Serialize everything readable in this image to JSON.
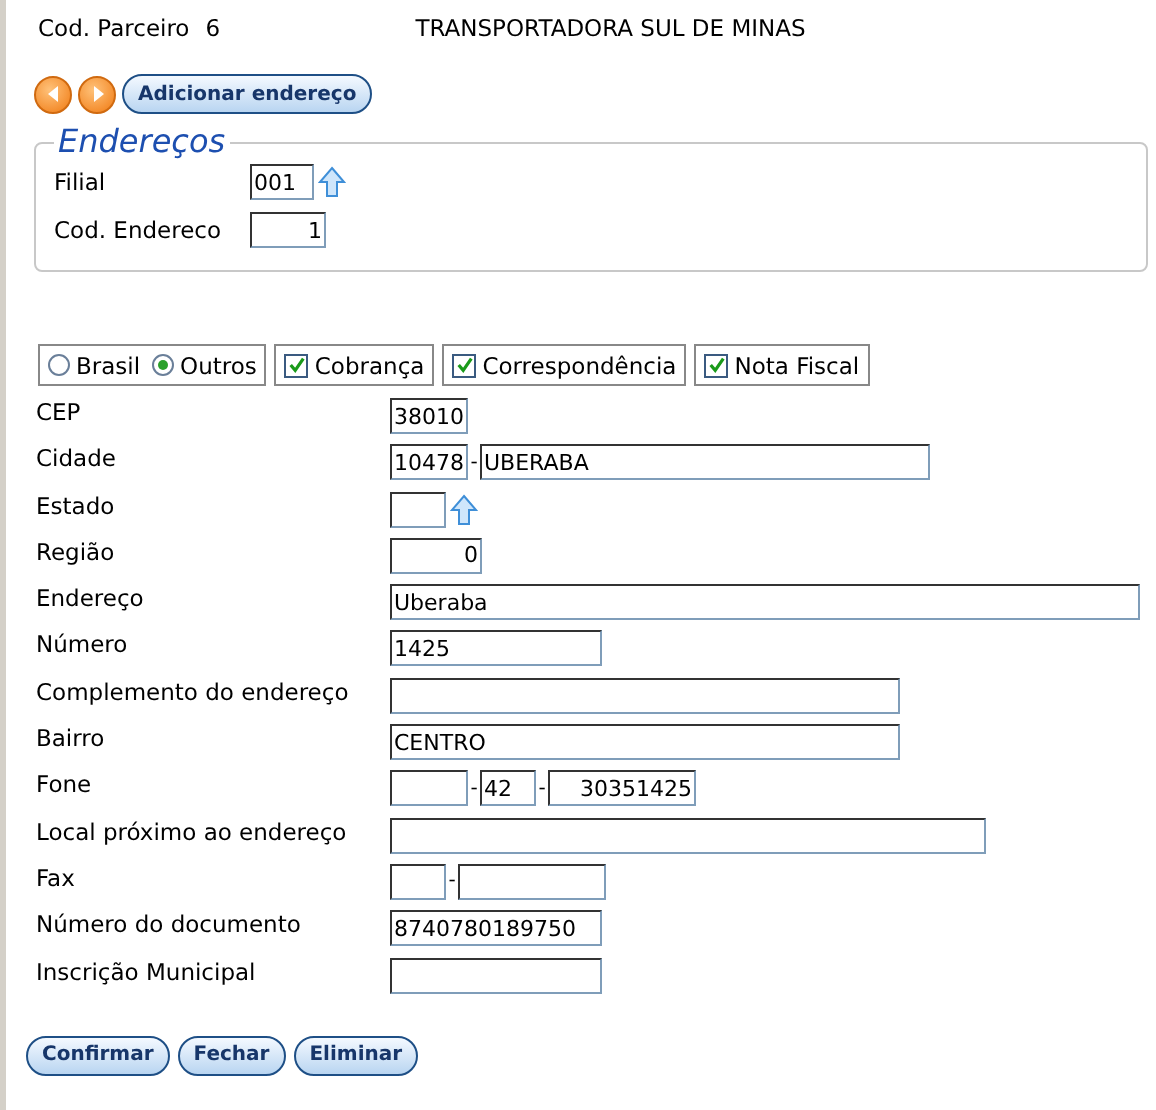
{
  "header": {
    "label": "Cod. Parceiro",
    "code": "6",
    "name": "TRANSPORTADORA SUL DE MINAS"
  },
  "nav": {
    "add_button": "Adicionar endereço"
  },
  "enderecos": {
    "legend": "Endereços",
    "filial": {
      "label": "Filial",
      "value": "001"
    },
    "cod_endereco": {
      "label": "Cod. Endereco",
      "value": "1"
    }
  },
  "options": {
    "radios": [
      {
        "label": "Brasil",
        "selected": false
      },
      {
        "label": "Outros",
        "selected": true
      }
    ],
    "checks": [
      {
        "label": "Cobrança",
        "checked": true
      },
      {
        "label": "Correspondência",
        "checked": true
      },
      {
        "label": "Nota Fiscal",
        "checked": true
      }
    ]
  },
  "fields": [
    {
      "label": "CEP",
      "inputs": [
        {
          "kind": "code",
          "value": "38010"
        }
      ]
    },
    {
      "label": "Cidade",
      "separator": "-",
      "inputs": [
        {
          "kind": "code",
          "value": "10478"
        },
        {
          "kind": "city",
          "value": "UBERABA"
        }
      ]
    },
    {
      "label": "Estado",
      "lookup": true,
      "inputs": [
        {
          "kind": "tiny"
        }
      ]
    },
    {
      "label": "Região",
      "inputs": [
        {
          "kind": "number",
          "value": "0"
        }
      ]
    },
    {
      "label": "Endereço",
      "inputs": [
        {
          "kind": "full",
          "value": "Uberaba"
        }
      ]
    },
    {
      "label": "Número",
      "inputs": [
        {
          "kind": "medium",
          "value": "1425"
        }
      ]
    },
    {
      "label": "Complemento do endereço",
      "inputs": [
        {
          "kind": "wide"
        }
      ]
    },
    {
      "label": "Bairro",
      "inputs": [
        {
          "kind": "wide",
          "value": "CENTRO"
        }
      ]
    },
    {
      "label": "Fone",
      "separator": "-",
      "inputs": [
        {
          "kind": "code"
        },
        {
          "kind": "tiny",
          "value": "42"
        },
        {
          "kind": "shortright",
          "value": "30351425"
        }
      ]
    },
    {
      "label": "Local próximo ao endereço",
      "inputs": [
        {
          "kind": "long"
        }
      ]
    },
    {
      "label": "Fax",
      "separator": "-",
      "inputs": [
        {
          "kind": "tiny"
        },
        {
          "kind": "short"
        }
      ]
    },
    {
      "label": "Número do documento",
      "inputs": [
        {
          "kind": "medium",
          "value": "8740780189750"
        }
      ]
    },
    {
      "label": "Inscrição Municipal",
      "inputs": [
        {
          "kind": "medium"
        }
      ]
    }
  ],
  "buttons": [
    "Confirmar",
    "Fechar",
    "Eliminar"
  ]
}
